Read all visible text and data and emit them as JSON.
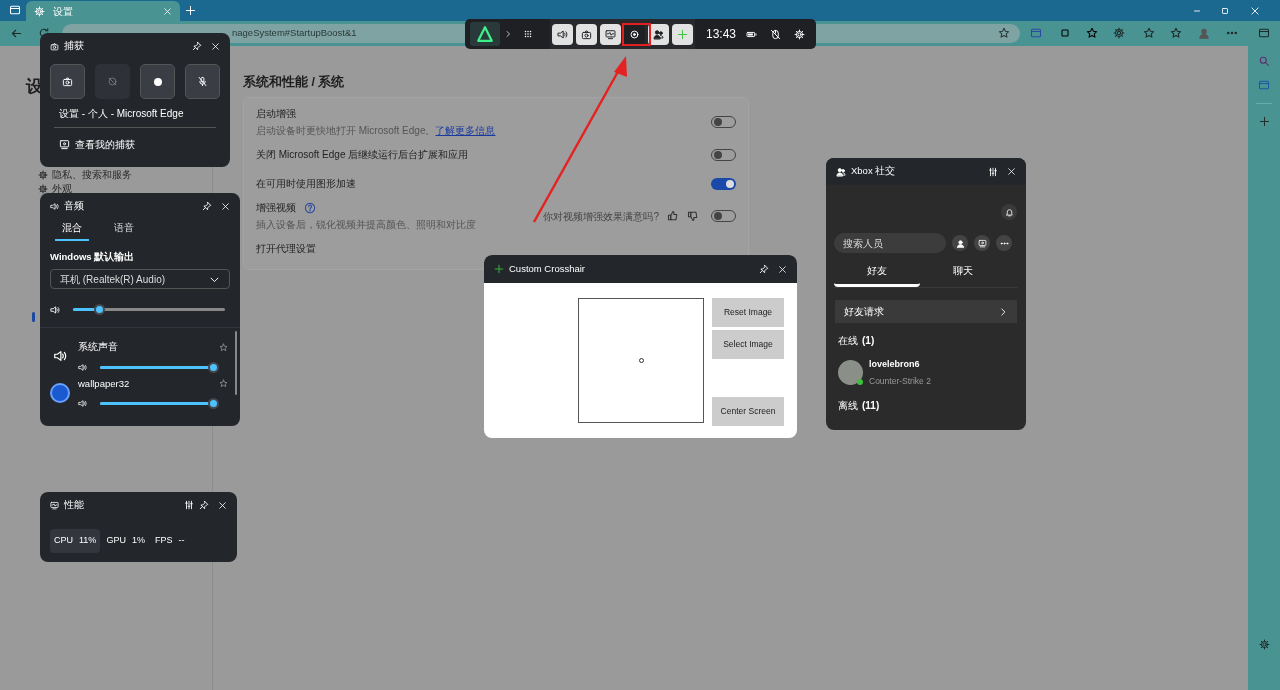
{
  "browser": {
    "tab_title": "设置",
    "address": "nageSystem#StartupBoost&1"
  },
  "settings": {
    "heading": "设",
    "nav": [
      "隐私、搜索和服务",
      "外观"
    ],
    "breadcrumb": "系统和性能 / 系统",
    "rows": [
      {
        "title": "启动增强",
        "description": "启动设备时更快地打开 Microsoft Edge。",
        "link": "了解更多信息",
        "on": false
      },
      {
        "title": "关闭 Microsoft Edge 后继续运行后台扩展和应用",
        "on": false
      },
      {
        "title": "在可用时使用图形加速",
        "on": true
      },
      {
        "title": "增强视频",
        "description": "插入设备后，锐化视频并提高颜色、照明和对比度",
        "feedback": "你对视频增强效果满意吗?",
        "on": false,
        "help": true
      },
      {
        "title": "打开代理设置"
      }
    ]
  },
  "game_bar": {
    "time": "13:43",
    "widgets": [
      {
        "kind": "audio",
        "on": true
      },
      {
        "kind": "capture",
        "on": true
      },
      {
        "kind": "performance",
        "on": true
      },
      {
        "kind": "crosshair",
        "on": false
      },
      {
        "kind": "social",
        "on": true
      },
      {
        "kind": "add",
        "on": true
      }
    ]
  },
  "capture": {
    "title": "捕获",
    "app": "设置 - 个人 - Microsoft Edge",
    "gallery_link": "查看我的捕获"
  },
  "audio": {
    "title": "音频",
    "tabs": [
      {
        "label": "混合",
        "selected": true
      },
      {
        "label": "语音",
        "selected": false
      }
    ],
    "output_label": "Windows 默认输出",
    "device": "耳机 (Realtek(R) Audio)",
    "master": {
      "level": 0.17
    },
    "apps": [
      {
        "kind": "speaker",
        "name": "系统声音",
        "level": 1
      },
      {
        "kind": "app",
        "name": "wallpaper32",
        "level": 1
      }
    ]
  },
  "performance": {
    "title": "性能",
    "stats": [
      {
        "label": "CPU",
        "value": "11%",
        "selected": true
      },
      {
        "label": "GPU",
        "value": "1%",
        "selected": false
      },
      {
        "label": "FPS",
        "value": "--",
        "selected": false
      }
    ]
  },
  "crosshair": {
    "title": "Custom Crosshair",
    "buttons": [
      "Reset Image",
      "Select Image",
      "Center Screen"
    ]
  },
  "social": {
    "title": "Xbox 社交",
    "search_placeholder": "搜索人员",
    "tabs": [
      {
        "label": "好友",
        "selected": true
      },
      {
        "label": "聊天",
        "selected": false
      }
    ],
    "requests": "好友请求",
    "online": {
      "label": "在线",
      "count": "(1)"
    },
    "friends": [
      {
        "name": "lovelebron6",
        "game": "Counter-Strike 2",
        "color": "#3cc13c"
      }
    ],
    "offline": {
      "label": "离线",
      "count": "(11)"
    }
  }
}
